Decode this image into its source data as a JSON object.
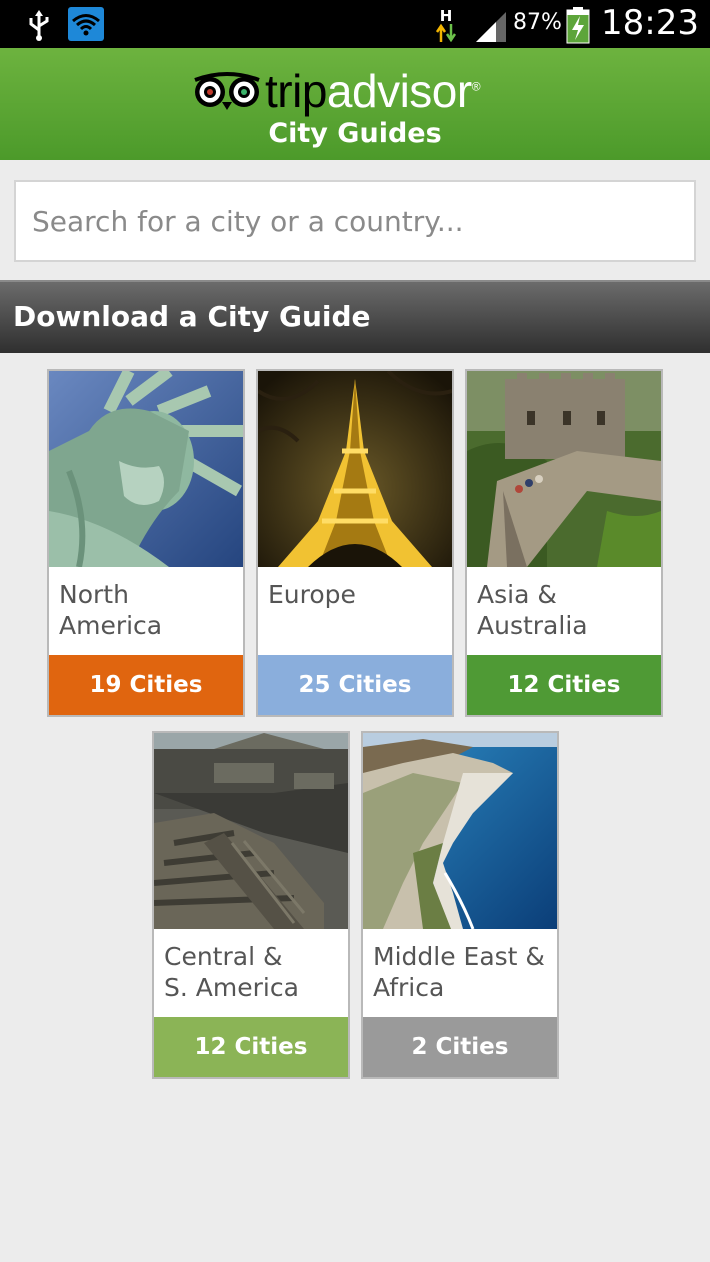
{
  "status_bar": {
    "network_type": "H",
    "battery": "87%",
    "time": "18:23"
  },
  "header": {
    "logo_trip": "trip",
    "logo_advisor": "advisor",
    "subtitle": "City Guides"
  },
  "search": {
    "placeholder": "Search for a city or a country..."
  },
  "section": {
    "title": "Download a City Guide"
  },
  "regions": [
    {
      "line1": "North",
      "line2": "America",
      "count": "19 Cities",
      "color": "#e0650f"
    },
    {
      "line1": "Europe",
      "line2": "",
      "count": "25 Cities",
      "color": "#8aaedc"
    },
    {
      "line1": "Asia &",
      "line2": "Australia",
      "count": "12 Cities",
      "color": "#4f9a35"
    },
    {
      "line1": "Central &",
      "line2": "S. America",
      "count": "12 Cities",
      "color": "#8bb456"
    },
    {
      "line1": "Middle East &",
      "line2": "Africa",
      "count": "2 Cities",
      "color": "#9a9a9a"
    }
  ]
}
